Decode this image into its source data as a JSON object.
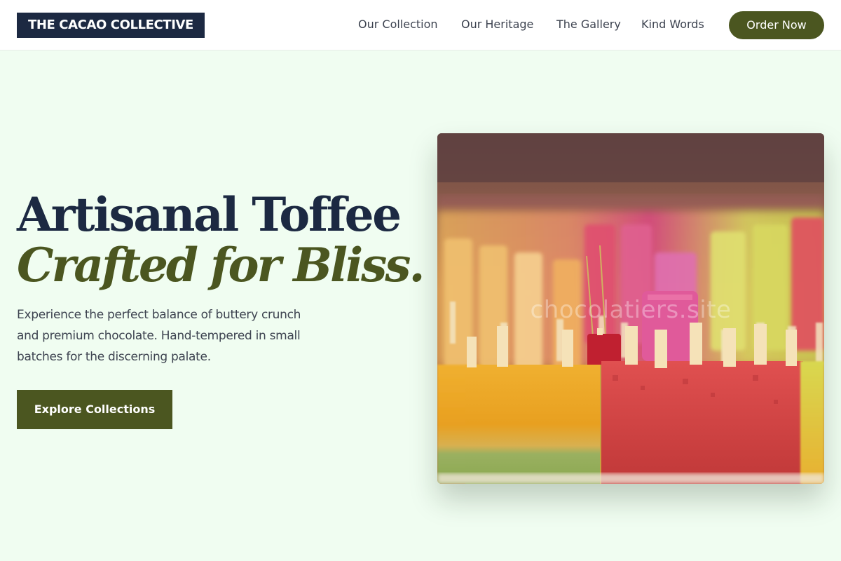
{
  "brand": {
    "name": "THE CACAO COLLECTIVE"
  },
  "nav": {
    "links": [
      "Our Collection",
      "Our Heritage",
      "The Gallery",
      "Kind Words"
    ],
    "cta_label": "Order Now"
  },
  "hero": {
    "title": "Artisanal Toffee",
    "title_accent": "Crafted for Bliss.",
    "description_lines": [
      "Experience the perfect balance of buttery crunch",
      "and premium chocolate. Hand-tempered in small",
      "batches for the discerning palate."
    ],
    "cta_label": "Explore Collections",
    "image": {
      "subject": "display case of colorful fruit popsicles on sticks",
      "watermark": "chocolatiers.site"
    }
  },
  "colors": {
    "page_background": "#f0fdf1",
    "navy": "#1c2942",
    "olive": "#4b5620",
    "text": "#3d4350"
  }
}
